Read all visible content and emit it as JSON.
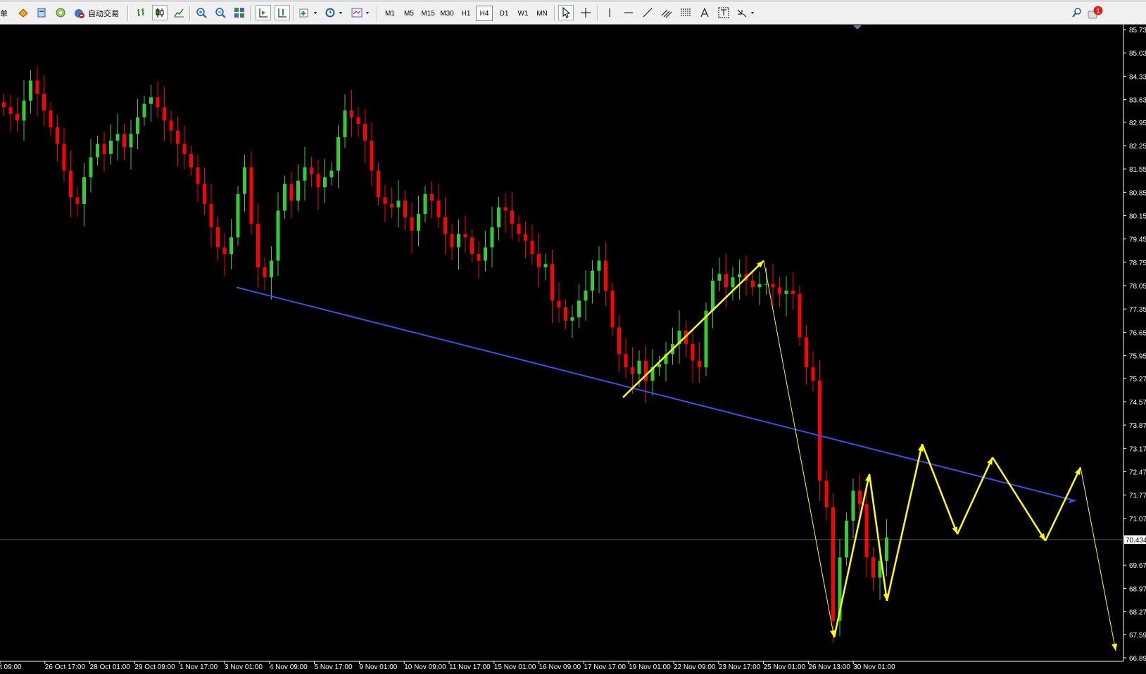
{
  "toolbar": {
    "menu_fragment": "单",
    "auto_trading_label": "自动交易",
    "timeframes": [
      "M1",
      "M5",
      "M15",
      "M30",
      "H1",
      "H4",
      "D1",
      "W1",
      "MN"
    ],
    "active_timeframe": "H4",
    "notification_count": "1",
    "icons": [
      "market-watch-icon",
      "navigator-icon",
      "data-window-icon",
      "signal-icon",
      "auto-trading-icon",
      "bar-chart-icon",
      "candlestick-icon",
      "line-chart-icon",
      "zoom-in-icon",
      "zoom-out-icon",
      "tile-windows-icon",
      "auto-scroll-icon",
      "chart-shift-icon",
      "indicators-icon",
      "periods-icon",
      "templates-icon",
      "cursor-icon",
      "crosshair-icon",
      "vertical-line-icon",
      "horizontal-line-icon",
      "trendline-icon",
      "equidistant-channel-icon",
      "fibonacci-icon",
      "text-icon",
      "text-label-icon",
      "arrows-icon",
      "search-icon",
      "notification-icon"
    ]
  },
  "chart_data": {
    "type": "candlestick",
    "symbol_timeframe": "H4",
    "price_axis_labels": [
      "85.730",
      "85.030",
      "84.330",
      "83.630",
      "82.950",
      "82.250",
      "81.550",
      "80.850",
      "80.150",
      "79.450",
      "78.750",
      "78.050",
      "77.350",
      "76.650",
      "75.950",
      "75.270",
      "74.570",
      "73.870",
      "73.170",
      "72.470",
      "71.770",
      "71.070",
      "69.670",
      "68.970",
      "68.270",
      "67.590",
      "66.890"
    ],
    "current_price": "70.434",
    "time_axis_labels": [
      "t 09:00",
      "26 Oct 17:00",
      "28 Oct 01:00",
      "29 Oct 09:00",
      "1 Nov 17:00",
      "3 Nov 01:00",
      "4 Nov 09:00",
      "5 Nov 17:00",
      "9 Nov 01:00",
      "10 Nov 09:00",
      "11 Nov 17:00",
      "15 Nov 01:00",
      "16 Nov 09:00",
      "17 Nov 17:00",
      "19 Nov 01:00",
      "22 Nov 09:00",
      "23 Nov 17:00",
      "25 Nov 01:00",
      "26 Nov 13:00",
      "30 Nov 01:00"
    ],
    "colors": {
      "up": "#33cc33",
      "down": "#ff0000",
      "background": "#000000",
      "trendline": "#3c50e6",
      "projection": "#ffff00",
      "axis_text": "#ffffff"
    },
    "grid": false,
    "close_path": [
      83.4,
      83.2,
      83.0,
      83.6,
      84.2,
      83.8,
      83.3,
      82.8,
      82.3,
      81.5,
      80.7,
      80.5,
      81.3,
      81.9,
      82.3,
      82.0,
      82.4,
      82.6,
      82.2,
      82.6,
      83.1,
      83.5,
      83.7,
      83.4,
      83.0,
      82.7,
      82.3,
      82.0,
      81.6,
      81.1,
      80.5,
      79.8,
      79.2,
      79.0,
      79.5,
      80.8,
      81.6,
      79.9,
      78.6,
      78.3,
      78.8,
      80.3,
      81.1,
      80.6,
      81.2,
      81.6,
      81.4,
      81.0,
      81.3,
      81.5,
      82.5,
      83.3,
      83.1,
      82.9,
      82.4,
      81.5,
      80.7,
      80.5,
      80.4,
      80.6,
      80.1,
      79.7,
      80.2,
      80.8,
      80.6,
      80.1,
      79.6,
      79.2,
      79.6,
      79.5,
      79.0,
      78.8,
      79.2,
      79.8,
      80.4,
      80.3,
      79.9,
      79.6,
      79.4,
      79.0,
      78.6,
      78.7,
      77.6,
      77.4,
      77.0,
      77.1,
      77.6,
      77.9,
      78.5,
      78.8,
      77.9,
      76.8,
      76.0,
      75.6,
      75.4,
      75.8,
      75.2,
      75.6,
      75.7,
      76.0,
      76.3,
      76.7,
      76.3,
      75.8,
      75.6,
      77.3,
      78.2,
      78.4,
      78.0,
      78.3,
      78.4,
      78.2,
      78.0,
      78.1,
      78.1,
      78.0,
      77.8,
      77.9,
      77.8,
      76.5,
      75.6,
      75.2,
      72.2,
      71.4,
      68.0,
      69.9,
      71.0,
      71.9,
      71.5,
      69.9,
      69.3,
      69.8,
      70.5
    ],
    "trendline": {
      "from": [
        "4 Nov 01:00",
        78.0
      ],
      "to": [
        "right edge",
        71.6
      ],
      "color": "blue"
    },
    "projection_path": [
      [
        19,
        74.7
      ],
      [
        23,
        78.8
      ],
      [
        25,
        67.5
      ],
      [
        26,
        72.4
      ],
      [
        26.5,
        68.6
      ],
      [
        27.5,
        73.3
      ],
      [
        28.5,
        70.6
      ],
      [
        29.5,
        72.9
      ],
      [
        31,
        70.4
      ],
      [
        32,
        72.6
      ],
      [
        33,
        67.1
      ]
    ]
  }
}
